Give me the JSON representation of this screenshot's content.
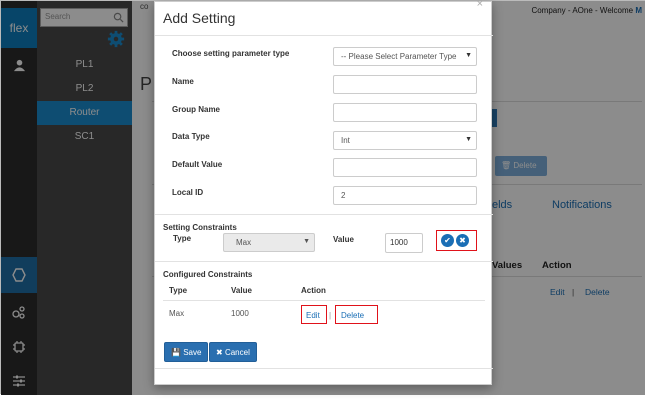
{
  "rail": {
    "logo": "flex"
  },
  "subnav": {
    "search_placeholder": "Search",
    "items": [
      {
        "label": "PL1"
      },
      {
        "label": "PL2"
      },
      {
        "label": "Router"
      },
      {
        "label": "SC1"
      }
    ]
  },
  "background": {
    "crumb": "co",
    "company_prefix": "Company - AOne - Welcome ",
    "company_initial": "M",
    "title_fragment": "P",
    "delete_label": "Delete",
    "tab_fields": "elds",
    "tab_notifications": "Notifications",
    "col_values": "Values",
    "col_action": "Action",
    "edit_link": "Edit",
    "pipe": "|",
    "delete_link": "Delete"
  },
  "modal": {
    "title": "Add Setting",
    "close": "×",
    "fields": {
      "param_type_label": "Choose setting parameter type",
      "param_type_value": "-- Please Select Parameter Type",
      "name_label": "Name",
      "name_value": "",
      "group_name_label": "Group Name",
      "group_name_value": "",
      "data_type_label": "Data Type",
      "data_type_value": "Int",
      "default_value_label": "Default Value",
      "default_value_value": "",
      "local_id_label": "Local ID",
      "local_id_value": "2"
    },
    "constraints": {
      "section_label": "Setting Constraints",
      "type_label": "Type",
      "type_value": "Max",
      "value_label": "Value",
      "value_value": "1000"
    },
    "configured": {
      "section_label": "Configured Constraints",
      "headers": {
        "type": "Type",
        "value": "Value",
        "action": "Action"
      },
      "rows": [
        {
          "type": "Max",
          "value": "1000",
          "edit": "Edit",
          "pipe": "|",
          "delete": "Delete"
        }
      ]
    },
    "buttons": {
      "save": "Save",
      "cancel": "Cancel"
    }
  },
  "colors": {
    "accent": "#1a6eb5",
    "highlight": "#e0121a",
    "rail_bg": "#2d2d2d",
    "subnav_active": "#1a8dd0"
  }
}
